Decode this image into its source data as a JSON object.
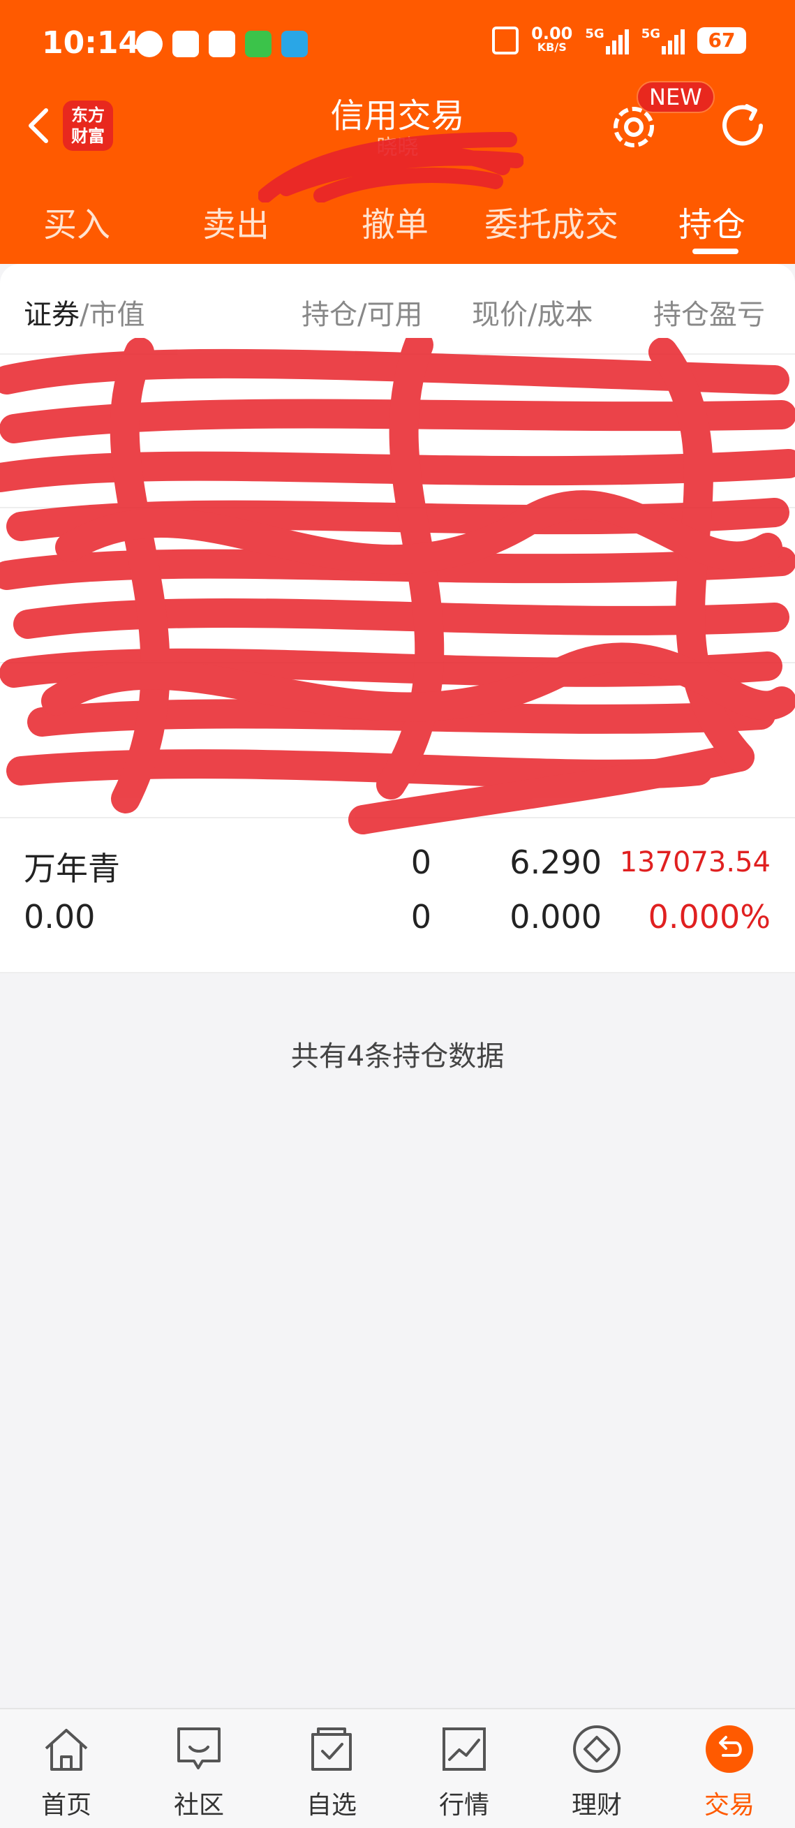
{
  "status_bar": {
    "time": "10:14",
    "net_speed_value": "0.00",
    "net_speed_unit": "KB/S",
    "signal1": "5G",
    "signal2": "5G",
    "battery": "67"
  },
  "header": {
    "logo_line1": "东方",
    "logo_line2": "财富",
    "title": "信用交易",
    "subtitle": "晓晓",
    "new_badge": "NEW"
  },
  "tabs": [
    {
      "label": "买入"
    },
    {
      "label": "卖出"
    },
    {
      "label": "撤单"
    },
    {
      "label": "委托成交"
    },
    {
      "label": "持仓",
      "active": true
    }
  ],
  "table": {
    "col_security": "证券",
    "col_market_value": "/市值",
    "col_position": "持仓/可用",
    "col_price": "现价/成本",
    "col_pnl": "持仓盈亏"
  },
  "positions": [
    {
      "name": "万年青",
      "market_value": "0.00",
      "position": "0",
      "available": "0",
      "price": "6.290",
      "cost": "0.000",
      "pnl": "137073.54",
      "pnl_pct": "0.000%"
    }
  ],
  "footer_message": "共有4条持仓数据",
  "bottom_nav": [
    {
      "label": "首页",
      "icon": "home-icon"
    },
    {
      "label": "社区",
      "icon": "community-icon"
    },
    {
      "label": "自选",
      "icon": "watchlist-icon"
    },
    {
      "label": "行情",
      "icon": "market-icon"
    },
    {
      "label": "理财",
      "icon": "wealth-icon"
    },
    {
      "label": "交易",
      "icon": "trade-icon",
      "active": true
    }
  ],
  "colors": {
    "brand_orange": "#ff5a00",
    "loss_red": "#e02020",
    "redaction": "#e8232a"
  }
}
